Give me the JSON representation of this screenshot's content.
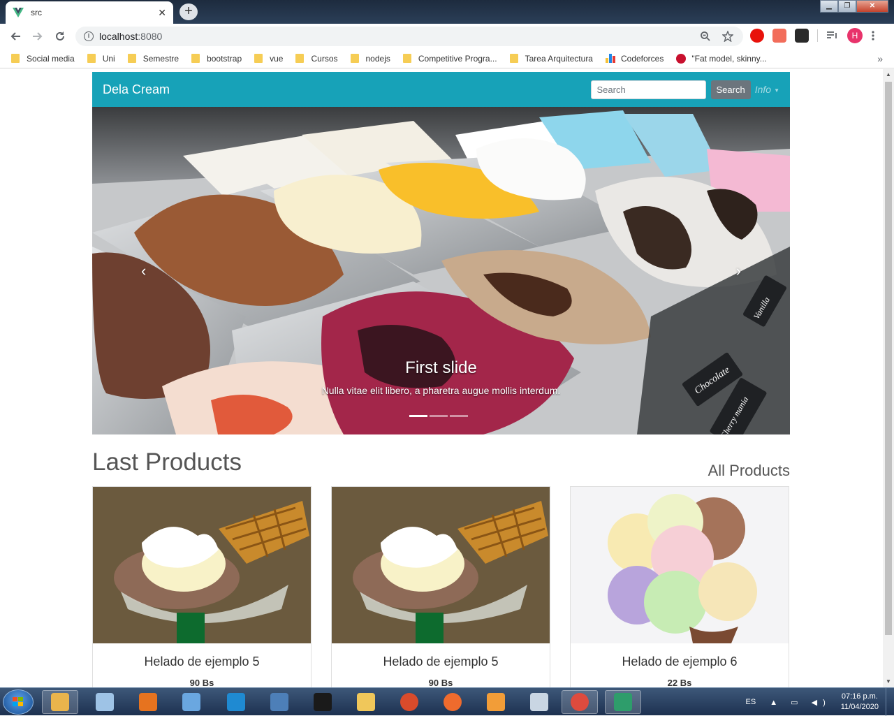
{
  "browser": {
    "tab_title": "src",
    "tab_close": "✕",
    "new_tab": "+",
    "url_host": "localhost",
    "url_port": ":8080",
    "window_controls": {
      "minimize": "▁",
      "maximize": "❐",
      "close": "✕"
    },
    "avatar_letter": "H",
    "bookmarks": [
      {
        "label": "Social media",
        "icon": "folder-icon"
      },
      {
        "label": "Uni",
        "icon": "folder-icon"
      },
      {
        "label": "Semestre",
        "icon": "folder-icon"
      },
      {
        "label": "bootstrap",
        "icon": "folder-icon"
      },
      {
        "label": "vue",
        "icon": "folder-icon"
      },
      {
        "label": "Cursos",
        "icon": "folder-icon"
      },
      {
        "label": "nodejs",
        "icon": "folder-icon"
      },
      {
        "label": "Competitive Progra...",
        "icon": "folder-icon"
      },
      {
        "label": "Tarea Arquitectura",
        "icon": "folder-icon"
      },
      {
        "label": "Codeforces",
        "icon": "codeforces-icon"
      },
      {
        "label": "\"Fat model, skinny...",
        "icon": "jc-icon"
      }
    ]
  },
  "site": {
    "brand": "Dela Cream",
    "search_placeholder": "Search",
    "search_button": "Search",
    "info_menu": "Info",
    "carousel": {
      "title": "First slide",
      "text": "Nulla vitae elit libero, a pharetra augue mollis interdum.",
      "indicator_count": 3,
      "active_index": 0,
      "labels_in_image": [
        "Chocolate",
        "Cherry mania",
        "Vanilla"
      ]
    },
    "section_title": "Last Products",
    "all_products_link": "All Products",
    "products": [
      {
        "name": "Helado de ejemplo 5",
        "price": "90 Bs"
      },
      {
        "name": "Helado de ejemplo 5",
        "price": "90 Bs"
      },
      {
        "name": "Helado de ejemplo 6",
        "price": "22 Bs"
      }
    ]
  },
  "taskbar": {
    "language": "ES",
    "time": "07:16 p.m.",
    "date": "11/04/2020",
    "apps": [
      "paint-icon",
      "virtualbox-cube-icon",
      "microphone-icon",
      "box-icon",
      "vscode-icon",
      "postgres-icon",
      "terminal-icon",
      "file-explorer-icon",
      "ccleaner-icon",
      "postman-icon",
      "sublime-icon",
      "cube-app-icon",
      "chrome-icon",
      "gitkraken-icon"
    ]
  },
  "colors": {
    "navbar": "#17a2b8",
    "search_button": "#6c757d",
    "brand_text": "#ffffff"
  }
}
